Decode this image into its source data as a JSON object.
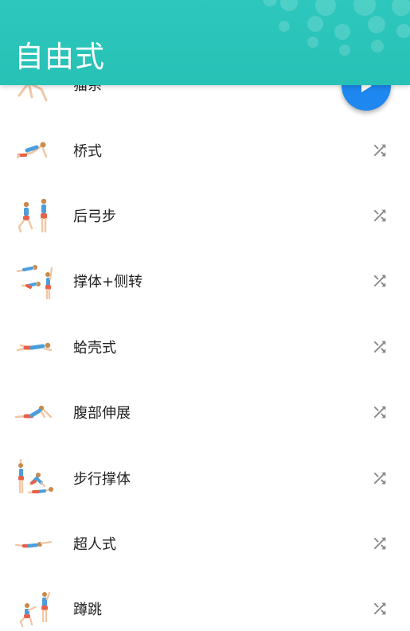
{
  "header": {
    "title": "自由式"
  },
  "fab": {
    "icon": "play-icon",
    "color": "#1e88f0"
  },
  "colors": {
    "header_bg": "#2ec7bd",
    "shuffle_icon": "#8a8a8a",
    "text": "#222222"
  },
  "exercises": [
    {
      "label": "猫系",
      "icon": "shuffle-icon"
    },
    {
      "label": "桥式",
      "icon": "shuffle-icon"
    },
    {
      "label": "后弓步",
      "icon": "shuffle-icon"
    },
    {
      "label": "撑体+侧转",
      "icon": "shuffle-icon"
    },
    {
      "label": "蛤壳式",
      "icon": "shuffle-icon"
    },
    {
      "label": "腹部伸展",
      "icon": "shuffle-icon"
    },
    {
      "label": "步行撑体",
      "icon": "shuffle-icon"
    },
    {
      "label": "超人式",
      "icon": "shuffle-icon"
    },
    {
      "label": "蹲跳",
      "icon": "shuffle-icon"
    }
  ]
}
